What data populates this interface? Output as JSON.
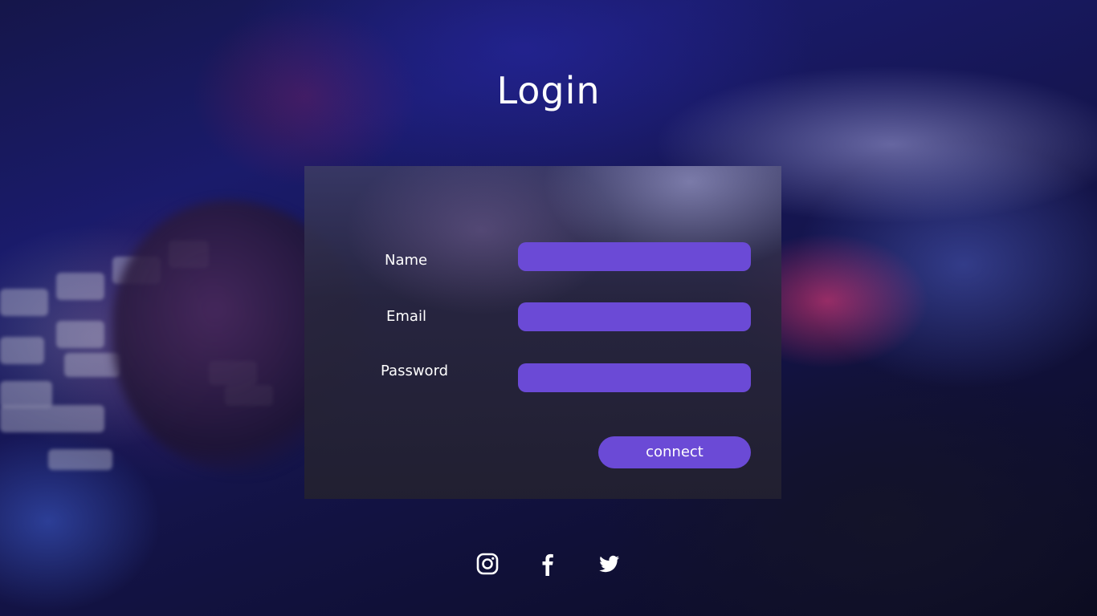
{
  "page": {
    "title": "Login"
  },
  "form": {
    "name_label": "Name",
    "email_label": "Email",
    "password_label": "Password",
    "name_value": "",
    "email_value": "",
    "password_value": "",
    "connect_label": "connect"
  },
  "socials": [
    {
      "icon": "instagram-icon"
    },
    {
      "icon": "facebook-icon"
    },
    {
      "icon": "twitter-icon"
    }
  ],
  "colors": {
    "accent": "#6b4ad6",
    "text": "#ffffff",
    "panel": "#2a2840"
  }
}
